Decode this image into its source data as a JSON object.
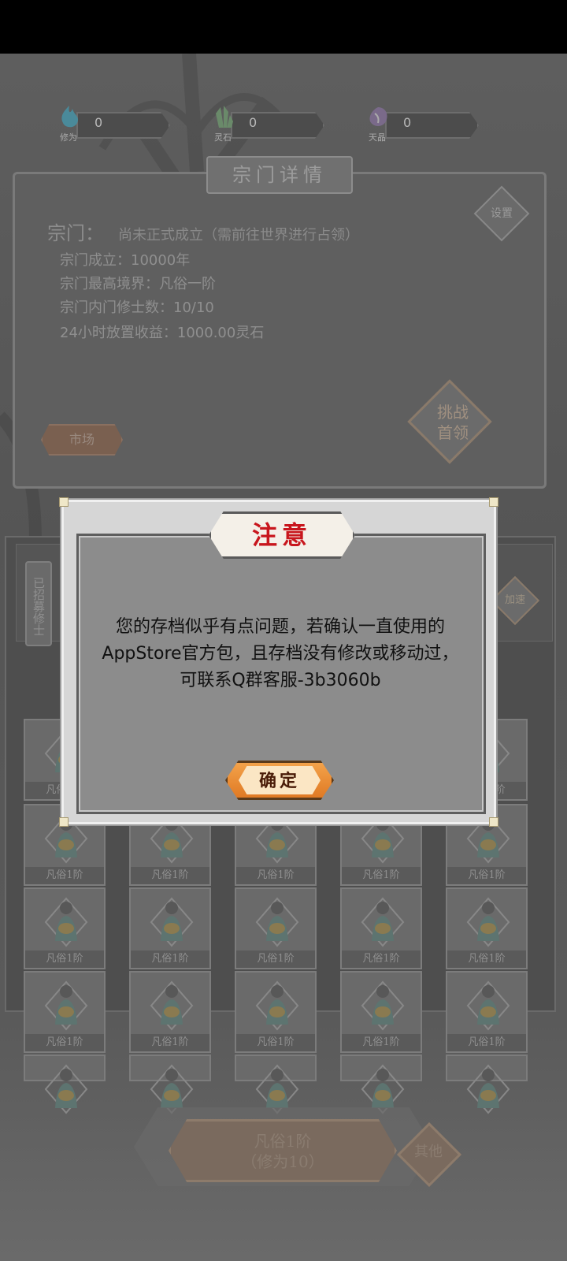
{
  "resources": [
    {
      "label": "修为",
      "value": "0"
    },
    {
      "label": "灵石",
      "value": "0"
    },
    {
      "label": "天晶",
      "value": "0"
    }
  ],
  "sect_panel": {
    "title": "宗门详情",
    "settings_label": "设置",
    "sect_label": "宗门：",
    "sect_status": "尚未正式成立（需前往世界进行占领）",
    "info_lines": [
      "宗门成立：10000年",
      "宗门最高境界：凡俗一阶",
      "宗门内门修士数：10/10",
      "24小时放置收益：1000.00灵石"
    ],
    "challenge_label": [
      "挑战",
      "首领"
    ],
    "market_label": "市场"
  },
  "recruit": {
    "tab_label": "已招募修士",
    "speed_label": "加速",
    "card_label": "凡俗1阶"
  },
  "bottom": {
    "realm_line1": "凡俗1阶",
    "realm_line2": "（修为10）",
    "other_label": "其他"
  },
  "modal": {
    "title": "注意",
    "message": "您的存档似乎有点问题，若确认一直使用的AppStore官方包，且存档没有修改或移动过，可联系Q群客服-3b3060b",
    "confirm_label": "确定"
  }
}
